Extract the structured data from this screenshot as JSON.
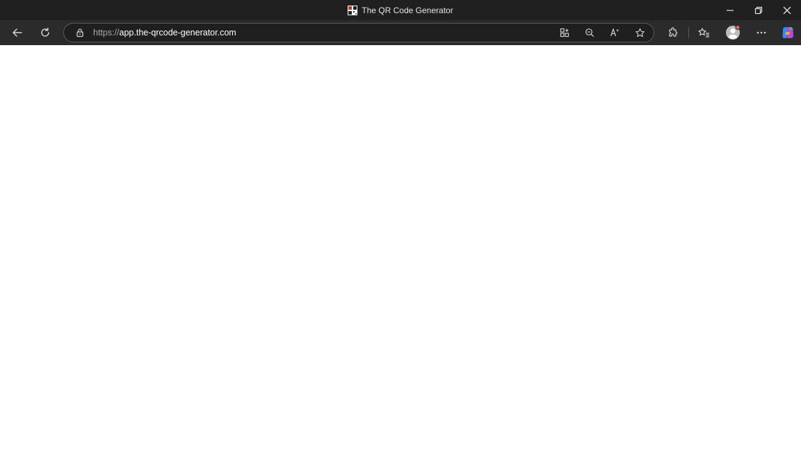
{
  "window": {
    "title": "The QR Code Generator",
    "favicon_icon": "qr-favicon-icon",
    "controls": [
      "minimize-icon",
      "restore-icon",
      "close-icon"
    ]
  },
  "toolbar": {
    "back_icon": "back-arrow-icon",
    "refresh_icon": "refresh-icon",
    "address": {
      "lock_icon": "lock-icon",
      "scheme": "https://",
      "host": "app.the-qrcode-generator.com"
    },
    "address_actions": [
      "apps-icon",
      "zoom-out-icon",
      "read-aloud-icon",
      "favorite-star-icon"
    ],
    "right_icons": [
      "extensions-icon",
      "favorites-icon",
      "profile-avatar-icon",
      "more-icon",
      "copilot-icon"
    ]
  },
  "colors": {
    "titlebar": "#202020",
    "toolbar": "#2b2b2b",
    "content": "#ffffff"
  }
}
